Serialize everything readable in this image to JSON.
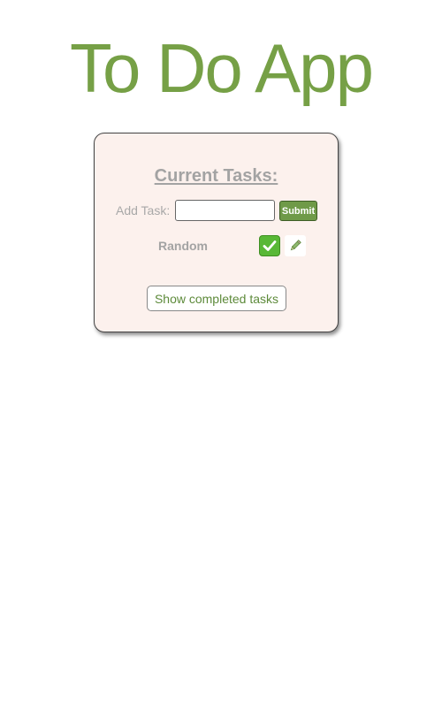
{
  "app": {
    "title": "To Do App"
  },
  "card": {
    "heading": "Current Tasks:",
    "add_task_label": "Add Task:",
    "input_value": "",
    "input_placeholder": "",
    "submit_label": "Submit",
    "tasks": [
      {
        "name": "Random",
        "complete_icon": "check-mark-icon",
        "edit_icon": "pencil-icon"
      }
    ],
    "show_completed_label": "Show completed tasks"
  },
  "colors": {
    "title_green": "#76a046",
    "card_background": "#fcf1ed",
    "submit_green": "#6f9a48",
    "check_green": "#58b836",
    "label_gray": "#a3a3a3"
  }
}
